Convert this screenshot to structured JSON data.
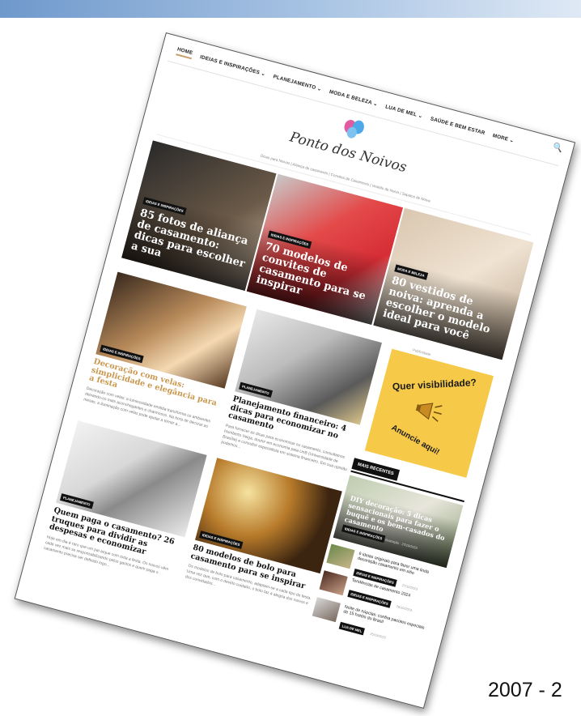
{
  "footer": {
    "year_text": "2007 - 2"
  },
  "nav": {
    "items": [
      "HOME",
      "IDEIAS E INSPIRAÇÕES ⌄",
      "PLANEJAMENTO ⌄",
      "MODA E BELEZA ⌄",
      "LUA DE MEL ⌄",
      "SAÚDE E BEM ESTAR",
      "MORE ⌄"
    ],
    "search_icon": "🔍"
  },
  "logo": {
    "text": "Ponto dos Noivos"
  },
  "tagline": "Dicas para Noivas | Aliança de casamento | Convites de Casamento | Vestido de Noiva | Sapatos de Noiva",
  "hero": [
    {
      "category": "IDEIAS E INSPIRAÇÕES",
      "title": "85 fotos de aliança de casamento: dicas para escolher a sua"
    },
    {
      "category": "IDEIAS E INSPIRAÇÕES",
      "title": "70 modelos de convites de casamento para se inspirar"
    },
    {
      "category": "MODA E BELEZA",
      "title": "80 vestidos de noiva: aprenda a escolher o modelo ideal para você"
    }
  ],
  "cards": [
    {
      "category": "Ideias e Inspirações",
      "title": "Decoração com velas: simplicidade e elegância para a festa",
      "excerpt": "Decoração com velas: a luminosidade emitida transforma os ambientes deixando-os mais aconchegantes e charmosos. Na hora de decorar as mesas, a iluminação com velas pode ajudar a tornar a..."
    },
    {
      "category": "Planejamento",
      "title": "Planejamento financeiro: 4 dicas para economizar no casamento",
      "excerpt": "Para fornecer as dicas para economizar no casamento, consultamos Humberto Veiga, doutor em economia pela UnB (Universidade de Brasília) e consultor especialista em sistema financeiro. Em sua opinião podemos..."
    },
    {
      "category": "Planejamento",
      "title": "Quem paga o casamento? 26 truques para dividir as despesas e economizar",
      "excerpt": "Hoje em dia é raro que um pai arque com toda a festa. Os noivos vêm cada vez mais se responsabilizando pelos gastos e quem paga o casamento precisa ser definido logo..."
    },
    {
      "category": "Ideias e Inspirações",
      "title": "80 modelos de bolo para casamento para se inspirar",
      "excerpt": "Os modelos de bolo para casamento, adaptam-se a cada tipo de festa. Uma vez que, com o devido cuidado, o bolo faz a alegria dos noivos e dos convidados..."
    }
  ],
  "ad": {
    "label": "Publicidade",
    "top_text": "Quer visibilidade?",
    "bottom_text": "Anuncie aqui!"
  },
  "recent": {
    "heading": "MAIS RECENTES",
    "main": {
      "title": "DIY decoração: 5 dicas sensacionais para fazer o buquê e os bem-casados do casamento",
      "category": "Ideias e Inspirações",
      "author": "Ilustração · 27/10/2023"
    },
    "items": [
      {
        "title": "6 ideias originais para fazer uma linda decoração casamento em sítio",
        "category": "Ideias e Inspirações",
        "date": "27/10/2023"
      },
      {
        "title": "Tendências de casamento 2024",
        "category": "Ideias e Inspirações",
        "date": "26/10/2023"
      },
      {
        "title": "Noite de núpcias: confira pacotes especiais de 15 hotéis do Brasil",
        "category": "Lua de Mel",
        "date": "25/10/2023"
      }
    ]
  },
  "colors": {
    "accent_gold": "#c9974d",
    "ad_yellow": "#f6c948",
    "badge_black": "#111111"
  }
}
